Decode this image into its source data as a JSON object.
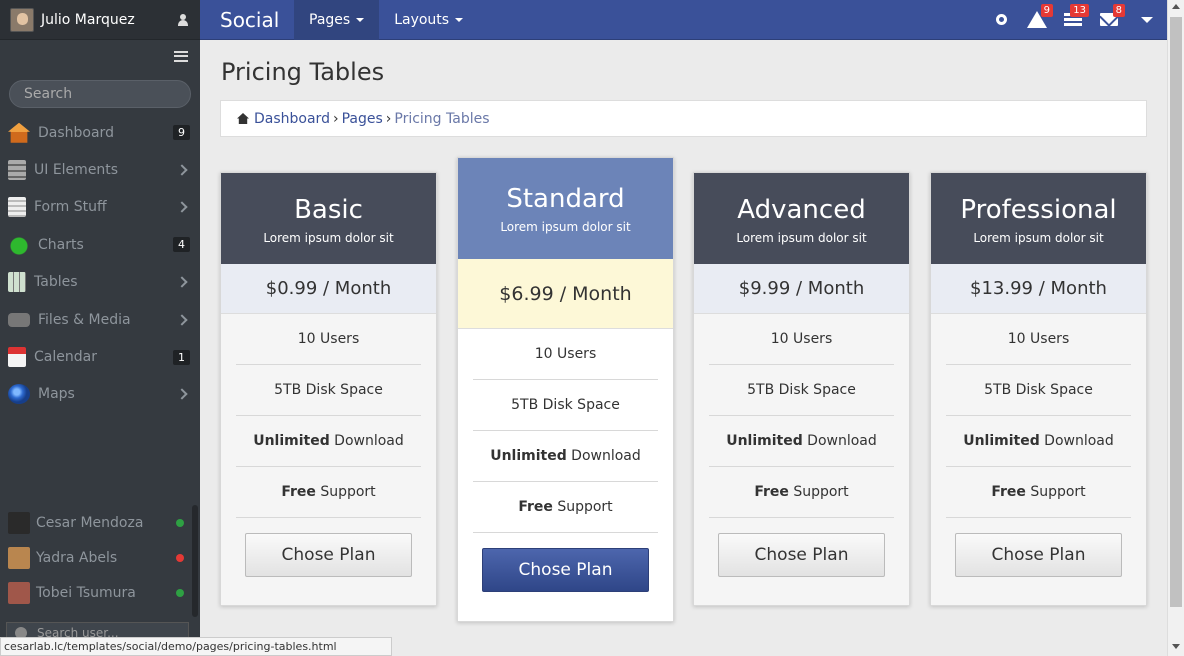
{
  "sidebar": {
    "user_name": "Julio Marquez",
    "search_placeholder": "Search",
    "items": [
      {
        "label": "Dashboard",
        "badge": "9"
      },
      {
        "label": "UI Elements"
      },
      {
        "label": "Form Stuff"
      },
      {
        "label": "Charts",
        "badge": "4"
      },
      {
        "label": "Tables"
      },
      {
        "label": "Files & Media"
      },
      {
        "label": "Calendar",
        "badge": "1"
      },
      {
        "label": "Maps"
      }
    ],
    "contacts": [
      {
        "name": "Cesar Mendoza",
        "status_color": "#2ea043"
      },
      {
        "name": "Yadra Abels",
        "status_color": "#e53935"
      },
      {
        "name": "Tobei Tsumura",
        "status_color": "#2ea043"
      }
    ],
    "search_user_placeholder": "Search user..."
  },
  "topbar": {
    "brand": "Social",
    "nav": [
      {
        "label": "Pages"
      },
      {
        "label": "Layouts"
      }
    ],
    "badges": {
      "alerts": "9",
      "news": "13",
      "messages": "8"
    }
  },
  "page": {
    "title": "Pricing Tables",
    "breadcrumb": [
      "Dashboard",
      "Pages",
      "Pricing Tables"
    ],
    "separator": "›"
  },
  "plans": [
    {
      "name": "Basic",
      "sub": "Lorem ipsum dolor sit",
      "price": "$0.99 / Month",
      "features": [
        "10 Users",
        "5TB Disk Space"
      ],
      "download_bold": "Unlimited",
      "download_rest": " Download",
      "support_bold": "Free",
      "support_rest": " Support",
      "button": "Chose Plan",
      "header_color": "#474c5a",
      "price_bg": "#e9ecf3"
    },
    {
      "name": "Standard",
      "sub": "Lorem ipsum dolor sit",
      "price": "$6.99 / Month",
      "features": [
        "10 Users",
        "5TB Disk Space"
      ],
      "download_bold": "Unlimited",
      "download_rest": " Download",
      "support_bold": "Free",
      "support_rest": " Support",
      "button": "Chose Plan",
      "header_color": "#6c84b8",
      "price_bg": "#fdf8d7"
    },
    {
      "name": "Advanced",
      "sub": "Lorem ipsum dolor sit",
      "price": "$9.99 / Month",
      "features": [
        "10 Users",
        "5TB Disk Space"
      ],
      "download_bold": "Unlimited",
      "download_rest": " Download",
      "support_bold": "Free",
      "support_rest": " Support",
      "button": "Chose Plan",
      "header_color": "#474c5a",
      "price_bg": "#e9ecf3"
    },
    {
      "name": "Professional",
      "sub": "Lorem ipsum dolor sit",
      "price": "$13.99 / Month",
      "features": [
        "10 Users",
        "5TB Disk Space"
      ],
      "download_bold": "Unlimited",
      "download_rest": " Download",
      "support_bold": "Free",
      "support_rest": " Support",
      "button": "Chose Plan",
      "header_color": "#474c5a",
      "price_bg": "#e9ecf3"
    }
  ],
  "status_url": "cesarlab.lc/templates/social/demo/pages/pricing-tables.html"
}
